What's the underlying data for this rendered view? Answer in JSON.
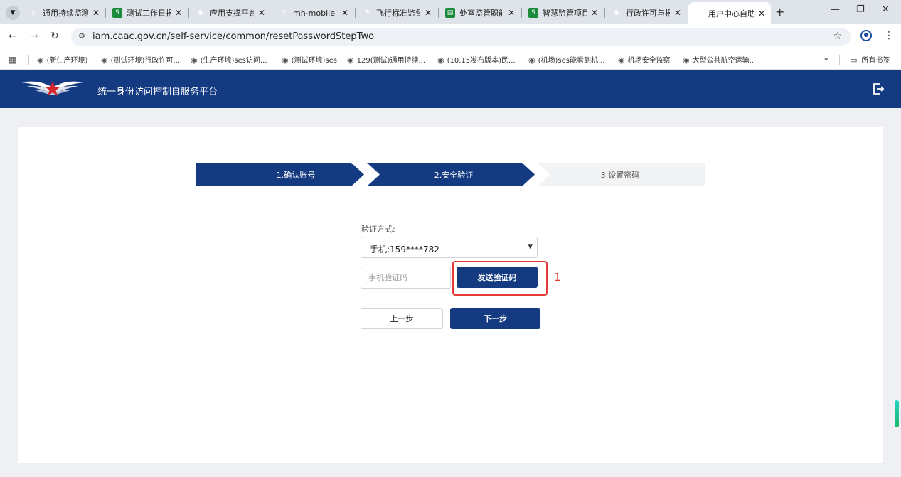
{
  "browser": {
    "tabs": [
      {
        "title": "通用持续监测",
        "favicon": "blue-swirl-icon"
      },
      {
        "title": "测试工作日报",
        "favicon": "sheet-icon",
        "badge": "S"
      },
      {
        "title": "应用支撑平台",
        "favicon": "globe-icon"
      },
      {
        "title": "mh-mobile",
        "favicon": "wing-icon"
      },
      {
        "title": "飞行标准监督",
        "favicon": "flag-icon"
      },
      {
        "title": "处室监管职能",
        "favicon": "sheet-icon",
        "badge": "▤"
      },
      {
        "title": "智慧监管项目",
        "favicon": "sheet-icon",
        "badge": "S"
      },
      {
        "title": "行政许可与报",
        "favicon": "globe-icon"
      },
      {
        "title": "用户中心自助",
        "favicon": "wing-icon"
      }
    ],
    "url": "iam.caac.gov.cn/self-service/common/resetPasswordStepTwo",
    "bookmarks": [
      "(新生产环境)",
      "(测试环境)行政许可...",
      "(生产环境)ses访问...",
      "(测试环境)ses",
      "129(测试)通用持续...",
      "(10.15发布版本)民...",
      "(机场)ses能看到机...",
      "机场安全监察",
      "大型公共航空运输..."
    ],
    "more_bookmarks": "»",
    "all_bookmarks": "所有书签"
  },
  "header": {
    "title": "统一身份访问控制自服务平台"
  },
  "steps": [
    {
      "label": "1.确认账号",
      "state": "done"
    },
    {
      "label": "2.安全验证",
      "state": "active"
    },
    {
      "label": "3.设置密码",
      "state": "pending"
    }
  ],
  "form": {
    "method_label": "验证方式:",
    "method_value": "手机:159****782",
    "code_placeholder": "手机验证码",
    "send_code_label": "发送验证码",
    "prev_label": "上一步",
    "next_label": "下一步"
  },
  "annotation": {
    "number": "1"
  },
  "colors": {
    "brand_navy": "#143b82",
    "highlight_red": "#e53935",
    "step_pending": "#f2f3f5"
  }
}
